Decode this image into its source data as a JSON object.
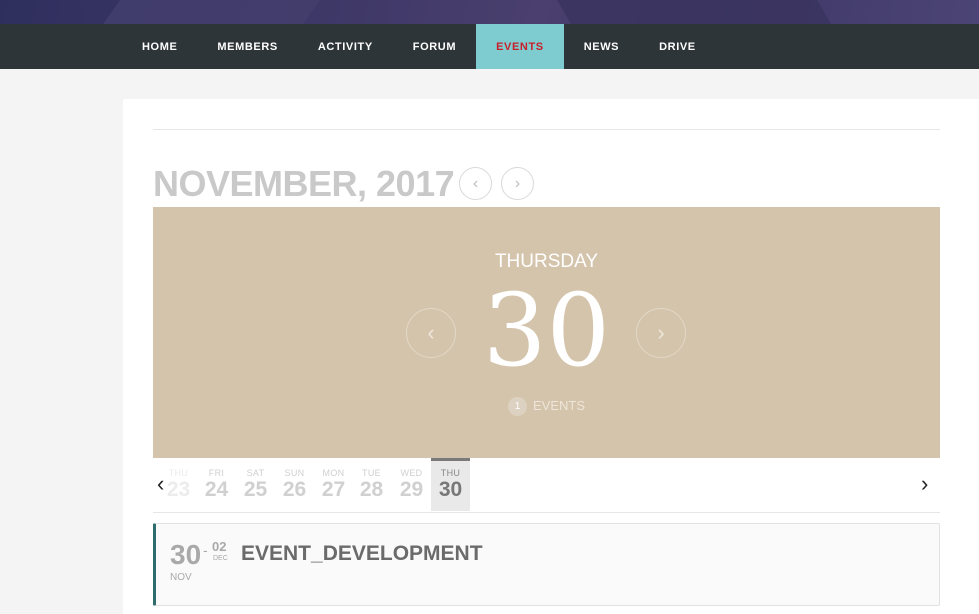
{
  "nav": {
    "items": [
      {
        "label": "HOME"
      },
      {
        "label": "MEMBERS"
      },
      {
        "label": "ACTIVITY"
      },
      {
        "label": "FORUM"
      },
      {
        "label": "EVENTS",
        "active": true
      },
      {
        "label": "NEWS"
      },
      {
        "label": "DRIVE"
      }
    ]
  },
  "calendar": {
    "month_title": "NOVEMBER, 2017",
    "prev_month_icon": "chevron-left-icon",
    "next_month_icon": "chevron-right-icon",
    "banner": {
      "weekday": "THURSDAY",
      "day": "30",
      "event_count": "1",
      "events_label": "EVENTS",
      "color": "#d4c4ab"
    },
    "days": [
      {
        "dow": "THU",
        "date": "23"
      },
      {
        "dow": "FRI",
        "date": "24"
      },
      {
        "dow": "SAT",
        "date": "25"
      },
      {
        "dow": "SUN",
        "date": "26"
      },
      {
        "dow": "MON",
        "date": "27"
      },
      {
        "dow": "TUE",
        "date": "28"
      },
      {
        "dow": "WED",
        "date": "29"
      },
      {
        "dow": "THU",
        "date": "30",
        "selected": true
      }
    ]
  },
  "event": {
    "start_day": "30",
    "start_month": "NOV",
    "end_day": "02",
    "end_month": "DEC",
    "separator": "-",
    "title": "EVENT_DEVELOPMENT"
  },
  "colors": {
    "nav_bg": "#2e3538",
    "active_tab_bg": "#7ecbd0",
    "active_tab_text": "#c8202a",
    "event_accent": "#2f6c6e"
  }
}
